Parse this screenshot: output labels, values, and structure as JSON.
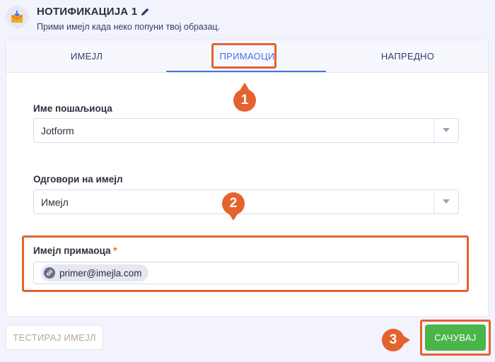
{
  "header": {
    "title": "НОТИФИКАЦИЈА 1",
    "subtitle": "Прими имејл када неко попуни твој образац."
  },
  "tabs": [
    {
      "label": "ИМЕЈЛ",
      "active": false
    },
    {
      "label": "ПРИМАОЦИ",
      "active": true
    },
    {
      "label": "НАПРЕДНО",
      "active": false
    }
  ],
  "fields": {
    "sender_name": {
      "label": "Име пошаљиоца",
      "value": "Jotform"
    },
    "reply_to": {
      "label": "Одговори на имејл",
      "value": "Имејл"
    },
    "recipient": {
      "label": "Имејл примаоца",
      "required_mark": "*",
      "chip": "primer@imejla.com"
    }
  },
  "markers": [
    "1",
    "2",
    "3"
  ],
  "footer": {
    "test_label": "ТЕСТИРАЈ ИМЕЈЛ",
    "save_label": "САЧУВАЈ"
  },
  "colors": {
    "accent": "#4573e3",
    "highlight": "#e4622e",
    "save": "#4ab549",
    "background": "#f3f3fe"
  },
  "icons": {
    "notification": "envelope-download-icon",
    "edit": "pencil-icon",
    "dropdown": "chevron-down-icon",
    "chip": "link-icon"
  }
}
